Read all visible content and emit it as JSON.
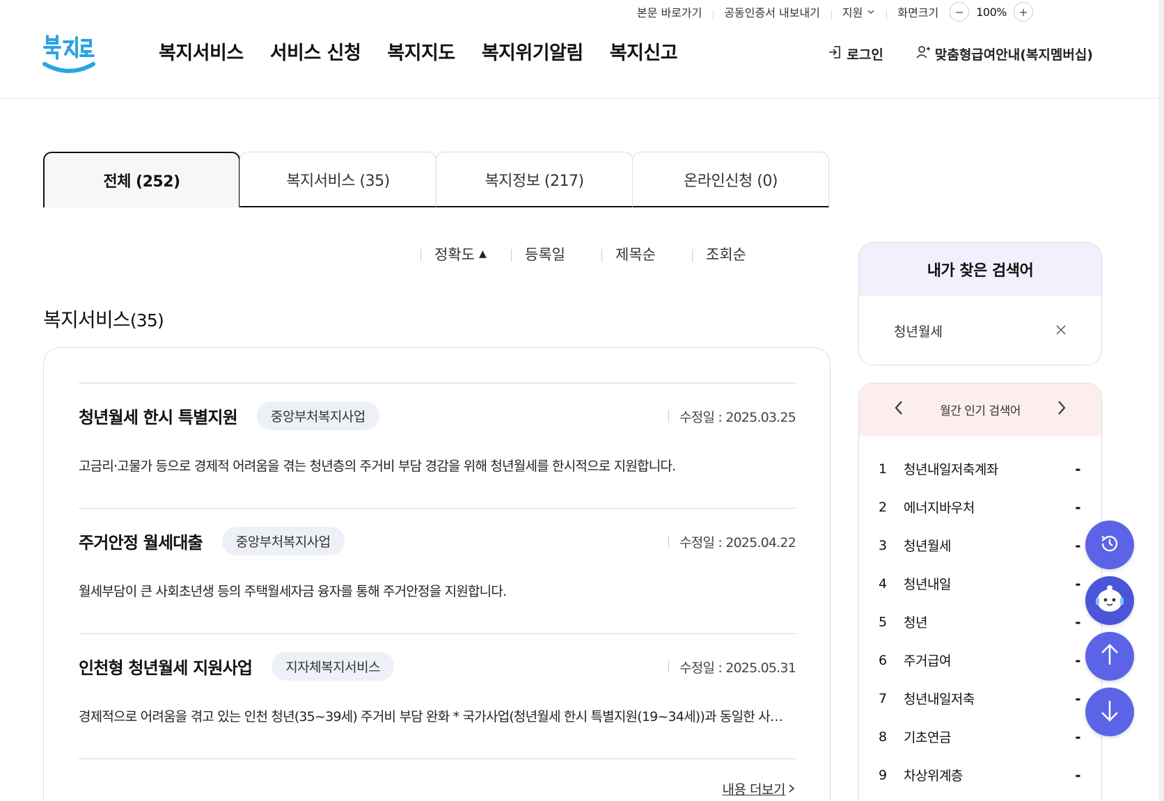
{
  "utility": {
    "skip_content": "본문 바로가기",
    "cert_export": "공동인증서 내보내기",
    "support": "지원",
    "screen_size": "화면크기",
    "zoom_minus": "−",
    "zoom_value": "100%",
    "zoom_plus": "+"
  },
  "header": {
    "logo_text": "복지로",
    "nav": [
      "복지서비스",
      "서비스 신청",
      "복지지도",
      "복지위기알림",
      "복지신고"
    ],
    "login": "로그인",
    "membership": "맞춤형급여안내(복지멤버십)"
  },
  "tabs": [
    {
      "label": "전체 (252)",
      "active": true
    },
    {
      "label": "복지서비스 (35)",
      "active": false
    },
    {
      "label": "복지정보 (217)",
      "active": false
    },
    {
      "label": "온라인신청 (0)",
      "active": false
    }
  ],
  "sort": {
    "options": [
      "정확도",
      "등록일",
      "제목순",
      "조회순"
    ],
    "indicator": "▲"
  },
  "section": {
    "title": "복지서비스",
    "count": "(35)"
  },
  "results": [
    {
      "title": "청년월세 한시 특별지원",
      "badge": "중앙부처복지사업",
      "modified": "수정일 : 2025.03.25",
      "desc": "고금리·고물가 등으로 경제적 어려움을 겪는 청년층의 주거비 부담 경감을 위해 청년월세를 한시적으로 지원합니다."
    },
    {
      "title": "주거안정 월세대출",
      "badge": "중앙부처복지사업",
      "modified": "수정일 : 2025.04.22",
      "desc": "월세부담이 큰 사회초년생 등의 주택월세자금 융자를 통해 주거안정을 지원합니다."
    },
    {
      "title": "인천형 청년월세 지원사업",
      "badge": "지자체복지서비스",
      "modified": "수정일 : 2025.05.31",
      "desc": "경제적으로 어려움을 겪고 있는 인천 청년(35~39세) 주거비 부담 완화 * 국가사업(청년월세 한시 특별지원(19~34세))과 동일한 사…"
    }
  ],
  "more_link": "내용 더보기",
  "my_search": {
    "title": "내가 찾은 검색어",
    "keyword": "청년월세"
  },
  "popular": {
    "title": "월간 인기 검색어",
    "items": [
      {
        "rank": "1",
        "keyword": "청년내일저축계좌",
        "change": "-"
      },
      {
        "rank": "2",
        "keyword": "에너지바우처",
        "change": "-"
      },
      {
        "rank": "3",
        "keyword": "청년월세",
        "change": "-"
      },
      {
        "rank": "4",
        "keyword": "청년내일",
        "change": "-"
      },
      {
        "rank": "5",
        "keyword": "청년",
        "change": "-"
      },
      {
        "rank": "6",
        "keyword": "주거급여",
        "change": "-"
      },
      {
        "rank": "7",
        "keyword": "청년내일저축",
        "change": "-"
      },
      {
        "rank": "8",
        "keyword": "기초연금",
        "change": "-"
      },
      {
        "rank": "9",
        "keyword": "차상위계층",
        "change": "-"
      }
    ]
  },
  "colors": {
    "brand_blue": "#2ba3e3",
    "fab": "#5b64e6",
    "my_search_head": "#f2f0fc",
    "popular_head": "#fdeeee",
    "badge_bg": "#eef0f8"
  }
}
